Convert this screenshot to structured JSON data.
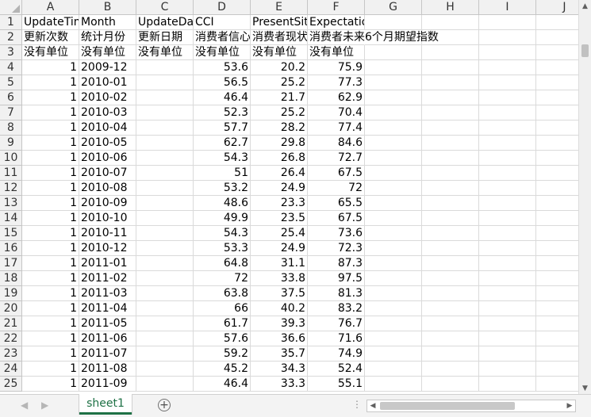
{
  "sheet": {
    "columns": [
      "A",
      "B",
      "C",
      "D",
      "E",
      "F",
      "G",
      "H",
      "I",
      "J"
    ],
    "rows": [
      {
        "num": "1",
        "a": "UpdateTime",
        "b": "Month",
        "c": "UpdateDate",
        "d": "CCI",
        "e": "PresentSituation",
        "f": "Expectations"
      },
      {
        "num": "2",
        "a": "更新次数",
        "b": "统计月份",
        "c": "更新日期",
        "d": "消费者信心指数",
        "e": "消费者现状指数",
        "f": "消费者未来6个月期望指数"
      },
      {
        "num": "3",
        "a": "没有单位",
        "b": "没有单位",
        "c": "没有单位",
        "d": "没有单位",
        "e": "没有单位",
        "f": "没有单位"
      },
      {
        "num": "4",
        "a": "1",
        "b": "2009-12",
        "c": "",
        "d": "53.6",
        "e": "20.2",
        "f": "75.9"
      },
      {
        "num": "5",
        "a": "1",
        "b": "2010-01",
        "c": "",
        "d": "56.5",
        "e": "25.2",
        "f": "77.3"
      },
      {
        "num": "6",
        "a": "1",
        "b": "2010-02",
        "c": "",
        "d": "46.4",
        "e": "21.7",
        "f": "62.9"
      },
      {
        "num": "7",
        "a": "1",
        "b": "2010-03",
        "c": "",
        "d": "52.3",
        "e": "25.2",
        "f": "70.4"
      },
      {
        "num": "8",
        "a": "1",
        "b": "2010-04",
        "c": "",
        "d": "57.7",
        "e": "28.2",
        "f": "77.4"
      },
      {
        "num": "9",
        "a": "1",
        "b": "2010-05",
        "c": "",
        "d": "62.7",
        "e": "29.8",
        "f": "84.6"
      },
      {
        "num": "10",
        "a": "1",
        "b": "2010-06",
        "c": "",
        "d": "54.3",
        "e": "26.8",
        "f": "72.7"
      },
      {
        "num": "11",
        "a": "1",
        "b": "2010-07",
        "c": "",
        "d": "51",
        "e": "26.4",
        "f": "67.5"
      },
      {
        "num": "12",
        "a": "1",
        "b": "2010-08",
        "c": "",
        "d": "53.2",
        "e": "24.9",
        "f": "72"
      },
      {
        "num": "13",
        "a": "1",
        "b": "2010-09",
        "c": "",
        "d": "48.6",
        "e": "23.3",
        "f": "65.5"
      },
      {
        "num": "14",
        "a": "1",
        "b": "2010-10",
        "c": "",
        "d": "49.9",
        "e": "23.5",
        "f": "67.5"
      },
      {
        "num": "15",
        "a": "1",
        "b": "2010-11",
        "c": "",
        "d": "54.3",
        "e": "25.4",
        "f": "73.6"
      },
      {
        "num": "16",
        "a": "1",
        "b": "2010-12",
        "c": "",
        "d": "53.3",
        "e": "24.9",
        "f": "72.3"
      },
      {
        "num": "17",
        "a": "1",
        "b": "2011-01",
        "c": "",
        "d": "64.8",
        "e": "31.1",
        "f": "87.3"
      },
      {
        "num": "18",
        "a": "1",
        "b": "2011-02",
        "c": "",
        "d": "72",
        "e": "33.8",
        "f": "97.5"
      },
      {
        "num": "19",
        "a": "1",
        "b": "2011-03",
        "c": "",
        "d": "63.8",
        "e": "37.5",
        "f": "81.3"
      },
      {
        "num": "20",
        "a": "1",
        "b": "2011-04",
        "c": "",
        "d": "66",
        "e": "40.2",
        "f": "83.2"
      },
      {
        "num": "21",
        "a": "1",
        "b": "2011-05",
        "c": "",
        "d": "61.7",
        "e": "39.3",
        "f": "76.7"
      },
      {
        "num": "22",
        "a": "1",
        "b": "2011-06",
        "c": "",
        "d": "57.6",
        "e": "36.6",
        "f": "71.6"
      },
      {
        "num": "23",
        "a": "1",
        "b": "2011-07",
        "c": "",
        "d": "59.2",
        "e": "35.7",
        "f": "74.9"
      },
      {
        "num": "24",
        "a": "1",
        "b": "2011-08",
        "c": "",
        "d": "45.2",
        "e": "34.3",
        "f": "52.4"
      },
      {
        "num": "25",
        "a": "1",
        "b": "2011-09",
        "c": "",
        "d": "46.4",
        "e": "33.3",
        "f": "55.1"
      }
    ]
  },
  "tabs": {
    "active": "sheet1"
  },
  "icons": {
    "add_sheet": "plus-icon",
    "nav_prev": "triangle-left-icon",
    "nav_next": "triangle-right-icon",
    "more": "ellipsis-icon",
    "scroll_up": "triangle-up-icon",
    "scroll_down": "triangle-down-icon",
    "scroll_left": "triangle-left-icon",
    "scroll_right": "triangle-right-icon"
  },
  "colors": {
    "active_tab": "#1e7145",
    "header_bg": "#f1f1f1",
    "gridline": "#dadada"
  }
}
